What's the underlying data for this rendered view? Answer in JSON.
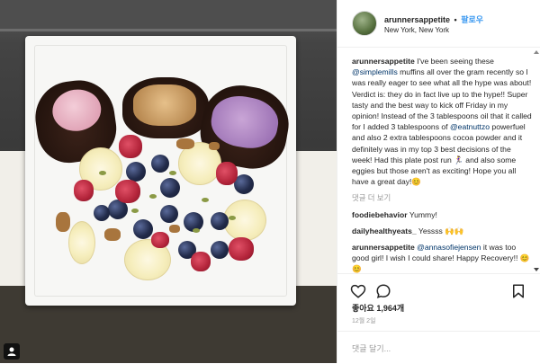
{
  "post": {
    "username": "arunnersappetite",
    "follow_label": "팔로우",
    "separator": "•",
    "location": "New York, New York",
    "caption_user": "arunnersappetite",
    "caption_parts": [
      " I've been seeing these ",
      "@simplemills",
      " muffins all over the gram recently so I was really eager to see what all the hype was about! Verdict is: they do in fact live up to the hype!! Super tasty and the best way to kick off Friday in my opinion! Instead of the 3 tablespoons oil that it called for I added 3 tablespoons of ",
      "@eatnuttzo",
      " powerfuel and also 2 extra tablespoons cocoa powder and it definitely was in my top 3 best decisions of the week! Had this plate post run 🏃‍♀️ and also some eggies but those aren't as exciting! Hope you all have a great day!😊"
    ],
    "view_replies": "댓글 더 보기",
    "comments": [
      {
        "user": "foodiebehavior",
        "text": " Yummy!"
      },
      {
        "user": "dailyhealthyeats_",
        "text": " Yessss 🙌🙌"
      },
      {
        "user": "arunnersappetite",
        "mention": "@annasofiejensen",
        "text": " it was too good girl! I wish I could share! Happy Recovery!! 😊😊"
      }
    ],
    "likes": "좋아요 1,964개",
    "date": "12월 2일",
    "add_comment_placeholder": "댓글 달기..."
  },
  "icons": {
    "like": "heart-icon",
    "comment": "comment-icon",
    "save": "bookmark-icon",
    "corner": "user-tag-icon"
  },
  "colors": {
    "link": "#003569",
    "follow": "#3897f0",
    "muted": "#999999"
  }
}
